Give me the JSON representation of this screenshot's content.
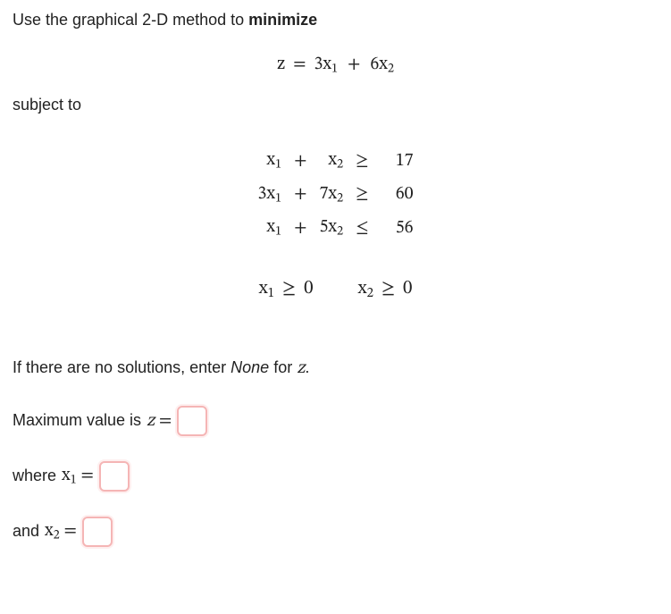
{
  "intro": {
    "pre": "Use the graphical 2-D method to ",
    "bold": "minimize"
  },
  "objective": {
    "lhs": "z",
    "eq": "=",
    "rhs_a": "3x",
    "rhs_a_sub": "1",
    "plus": "+",
    "rhs_b": "6x",
    "rhs_b_sub": "2"
  },
  "subject_to": "subject to",
  "constraints": [
    {
      "c1a": "x",
      "c1s": "1",
      "op1": "+",
      "c2a": "x",
      "c2s": "2",
      "rel": "≥",
      "rhs": "17"
    },
    {
      "c1a": "3x",
      "c1s": "1",
      "op1": "+",
      "c2a": "7x",
      "c2s": "2",
      "rel": "≥",
      "rhs": "60"
    },
    {
      "c1a": "x",
      "c1s": "1",
      "op1": "+",
      "c2a": "5x",
      "c2s": "2",
      "rel": "≤",
      "rhs": "56"
    }
  ],
  "nonneg": {
    "a_pre": "x",
    "a_sub": "1",
    "a_rel": "≥",
    "a_rhs": "0",
    "b_pre": "x",
    "b_sub": "2",
    "b_rel": "≥",
    "b_rhs": "0"
  },
  "note": {
    "pre": "If there are no solutions, enter ",
    "emph": "None",
    "post": " for ",
    "zvar": "z",
    "tail": "."
  },
  "answers": {
    "z_label_pre": "Maximum value is ",
    "z_var": "z",
    "z_eq": " = ",
    "x1_label_pre": "where ",
    "x1_var_pre": "x",
    "x1_sub": "1",
    "x1_eq": " = ",
    "x2_label_pre": "and ",
    "x2_var_pre": "x",
    "x2_sub": "2",
    "x2_eq": " = "
  }
}
